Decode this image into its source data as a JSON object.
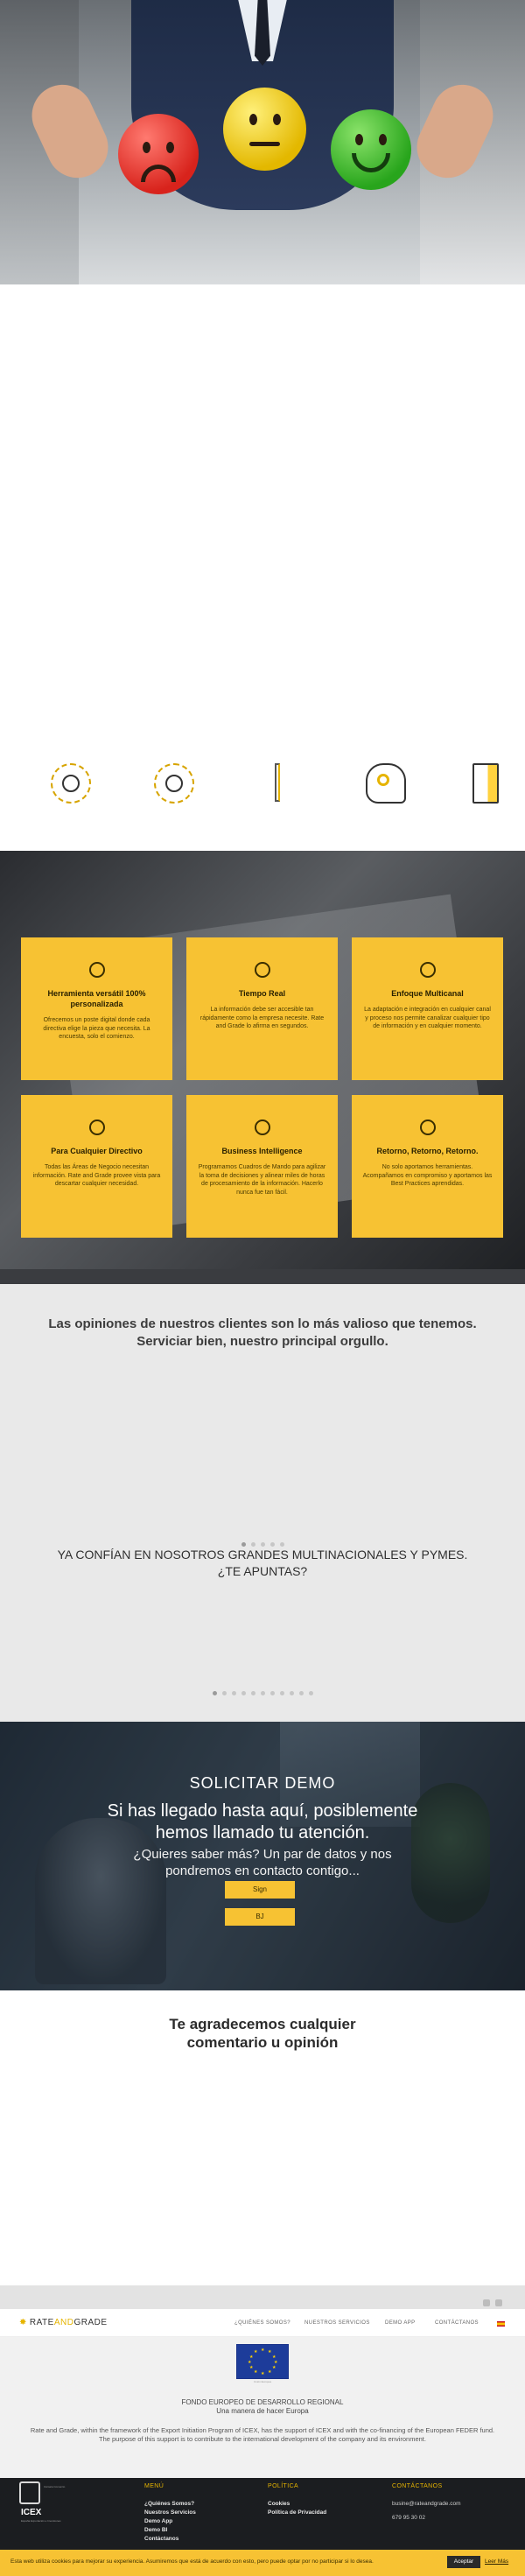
{
  "features": {
    "cards": [
      {
        "icon": "tools-icon",
        "title": "Herramienta versátil 100% personalizada",
        "text": "Ofrecemos un poste digital donde cada directiva elige la pieza que necesita. La encuesta, solo el comienzo."
      },
      {
        "icon": "clock-icon",
        "title": "Tiempo Real",
        "text": "La información debe ser accesible tan rápidamente como la empresa necesite. Rate and Grade lo afirma en segundos."
      },
      {
        "icon": "expand-icon",
        "title": "Enfoque Multicanal",
        "text": "La adaptación e integración en cualquier canal y proceso nos permite canalizar cualquier tipo de información y en cualquier momento."
      },
      {
        "icon": "director-icon",
        "title": "Para Cualquier Directivo",
        "text": "Todas las Áreas de Negocio necesitan información. Rate and Grade provee vista para descartar cualquier necesidad."
      },
      {
        "icon": "target-icon",
        "title": "Business Intelligence",
        "text": "Programamos Cuadros de Mando para agilizar la toma de decisiones y alinear miles de horas de procesamiento de la información. Hacerlo nunca fue tan fácil."
      },
      {
        "icon": "refresh-icon",
        "title": "Retorno, Retorno, Retorno.",
        "text": "No solo aportamos herramientas. Acompañamos en compromiso y aportamos las Best Practices aprendidas."
      }
    ]
  },
  "testimonials": {
    "heading_line1": "Las opiniones de nuestros clientes son lo más valioso que tenemos.",
    "heading_line2": "Serviciar bien, nuestro principal orgullo.",
    "clients_line1": "YA CONFÍAN EN NOSOTROS GRANDES MULTINACIONALES Y PYMES.",
    "clients_line2": "¿TE APUNTAS?"
  },
  "demo": {
    "title": "SOLICITAR DEMO",
    "headline_line1": "Si has llegado hasta aquí, posiblemente",
    "headline_line2": "hemos llamado tu atención.",
    "sub_line1": "¿Quieres saber más? Un par de datos y nos",
    "sub_line2": "pondremos en contacto contigo...",
    "button1": "Sign",
    "button2": "BJ"
  },
  "feedback": {
    "heading_line1": "Te agradecemos cualquier",
    "heading_line2": "comentario u opinión"
  },
  "header": {
    "logo_rate": "RATE",
    "logo_and": "AND",
    "logo_grade": "GRADE",
    "nav": [
      "¿QUIÉNES SOMOS?",
      "NUESTROS SERVICIOS",
      "DEMO APP",
      "CONTÁCTANOS"
    ]
  },
  "funding": {
    "eu_caption": "Unión Europea",
    "line1": "FONDO EUROPEO DE DESARROLLO REGIONAL",
    "line2": "Una manera de hacer Europa",
    "text": "Rate and Grade, within the framework of the Export Initiation Program of ICEX, has the support of ICEX and with the co-financing of the European FEDER fund. The purpose of this support is to contribute to the international development of the company and its environment."
  },
  "footer": {
    "logo1_caption": "Cámara Comercio",
    "icex": "ICEX",
    "icex_sub": "España Exportación e Inversiones",
    "menu_title": "MENÚ",
    "menu_items": [
      "¿Quiénes Somos?",
      "Nuestros Servicios",
      "Demo App",
      "Demo BI",
      "Contáctanos"
    ],
    "policy_title": "POLÍTICA",
    "policy_items": [
      "Cookies",
      "Política de Privacidad"
    ],
    "contact_title": "CONTÁCTANOS",
    "contact_email": "busine@rateandgrade.com",
    "contact_phone": "679 95 30 02"
  },
  "cookie": {
    "text": "Esta web utiliza cookies para mejorar su experiencia. Asumiremos que está de acuerdo con esto, pero puede optar por no participar si lo desea.",
    "accept": "Aceptar",
    "read_more": "Leer Más"
  },
  "colors": {
    "accent": "#f7c233",
    "dark": "#1b1d20",
    "grey_bg": "#e9e9e9"
  }
}
